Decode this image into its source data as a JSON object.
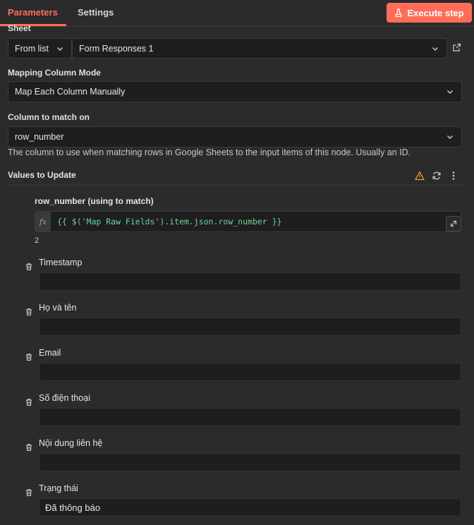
{
  "tabs": {
    "parameters": "Parameters",
    "settings": "Settings"
  },
  "execute_button": {
    "label": "Execute step"
  },
  "sheet": {
    "label": "Sheet",
    "mode": "From list",
    "value": "Form Responses 1"
  },
  "mapping_mode": {
    "label": "Mapping Column Mode",
    "value": "Map Each Column Manually"
  },
  "column_to_match": {
    "label": "Column to match on",
    "value": "row_number",
    "hint": "The column to use when matching rows in Google Sheets to the input items of this node. Usually an ID."
  },
  "values_to_update": {
    "title": "Values to Update",
    "match_field": {
      "label": "row_number (using to match)",
      "fx": "fx",
      "expression": "{{ $('Map Raw Fields').item.json.row_number }}",
      "result": "2"
    },
    "fields": [
      {
        "label": "Timestamp",
        "value": ""
      },
      {
        "label": "Họ và tên",
        "value": ""
      },
      {
        "label": "Email",
        "value": ""
      },
      {
        "label": "Số điện thoại",
        "value": ""
      },
      {
        "label": "Nội dung liên hệ",
        "value": ""
      },
      {
        "label": "Trạng thái",
        "value": "Đã thông báo"
      }
    ]
  },
  "colors": {
    "accent": "#ff6d5a",
    "expression_text": "#6fd39b",
    "warning": "#f0a020"
  },
  "icons": [
    "flask-icon",
    "chevron-down-icon",
    "external-link-icon",
    "warning-icon",
    "refresh-icon",
    "more-vertical-icon",
    "open-expression-icon",
    "trash-icon"
  ]
}
